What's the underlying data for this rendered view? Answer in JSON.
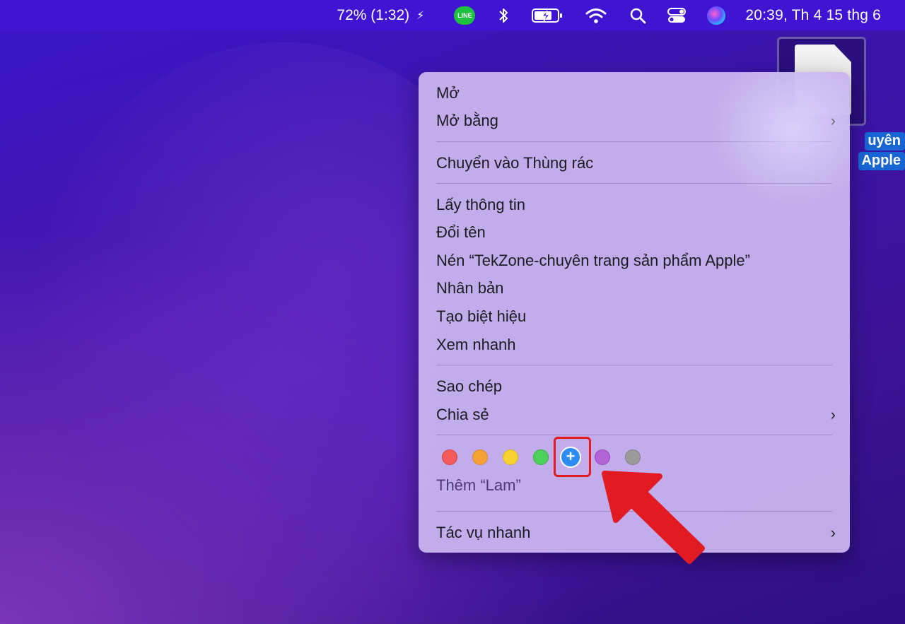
{
  "menubar": {
    "battery_text": "72% (1:32)",
    "charge_glyph": "⚡",
    "line_label": "LINE",
    "clock": "20:39, Th 4 15 thg 6",
    "icons": [
      "line-icon",
      "bluetooth-icon",
      "battery-icon",
      "wifi-icon",
      "search-icon",
      "control-center-icon",
      "siri-icon"
    ]
  },
  "desktop": {
    "file_label_line1": "uyên",
    "file_label_line2": "Apple"
  },
  "context_menu": {
    "open": "Mở",
    "open_with": "Mở bằng",
    "move_to_trash": "Chuyển vào Thùng rác",
    "get_info": "Lấy thông tin",
    "rename": "Đổi tên",
    "compress": "Nén “TekZone-chuyên trang sản phẩm Apple”",
    "duplicate": "Nhân bản",
    "make_alias": "Tạo biệt hiệu",
    "quick_look": "Xem nhanh",
    "copy": "Sao chép",
    "share": "Chia sẻ",
    "tag_hint": "Thêm “Lam”",
    "quick_actions": "Tác vụ nhanh",
    "submenu_glyph": "›",
    "tag_plus": "+",
    "tag_colors": [
      "#f35b5b",
      "#f6a133",
      "#f7d332",
      "#4ed15a",
      "#2b8cf5",
      "#b263d6",
      "#9b9b9b"
    ]
  },
  "annotation": {
    "highlight_color": "#e21b23",
    "arrow_color": "#e21b23"
  }
}
